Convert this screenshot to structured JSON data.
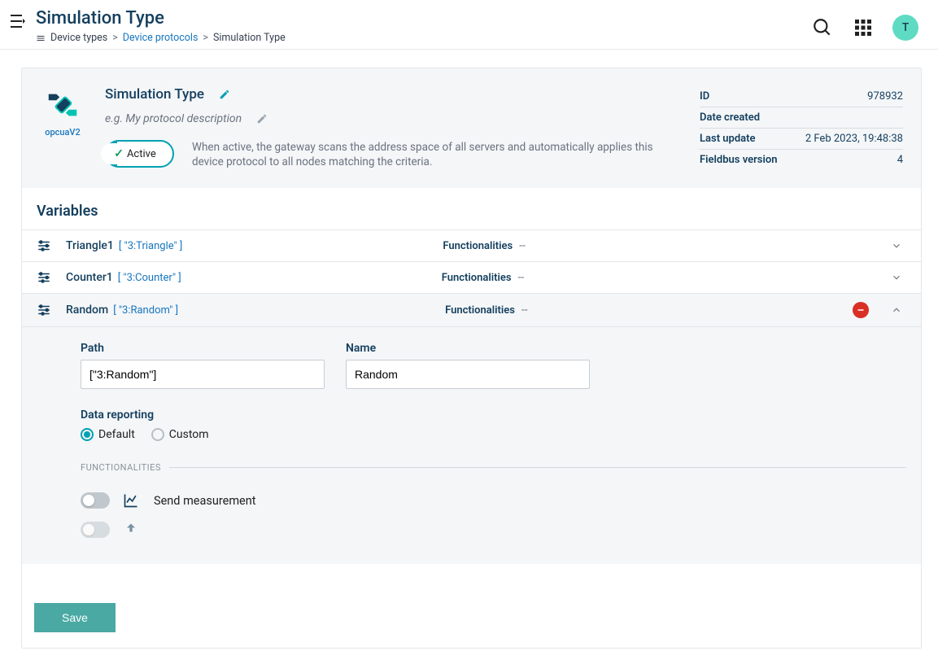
{
  "header": {
    "page_title": "Simulation Type",
    "avatar_letter": "T"
  },
  "breadcrumb": {
    "item0": "Device types",
    "item1": "Device protocols",
    "item2": "Simulation Type"
  },
  "protocol": {
    "icon_label": "opcuaV2",
    "title": "Simulation Type",
    "desc_placeholder": "e.g. My protocol description",
    "active_label": "Active",
    "active_help": "When active, the gateway scans the address space of all servers and automatically applies this device protocol to all nodes matching the criteria."
  },
  "meta": {
    "rows": [
      {
        "key": "ID",
        "val": "978932"
      },
      {
        "key": "Date created",
        "val": ""
      },
      {
        "key": "Last update",
        "val": "2 Feb 2023, 19:48:38"
      },
      {
        "key": "Fieldbus version",
        "val": "4"
      }
    ]
  },
  "variables": {
    "heading": "Variables",
    "func_label": "Functionalities",
    "func_dash": "--",
    "items": [
      {
        "name": "Triangle1",
        "badge": "[ \"3:Triangle\" ]",
        "expanded": false
      },
      {
        "name": "Counter1",
        "badge": "[ \"3:Counter\" ]",
        "expanded": false
      },
      {
        "name": "Random",
        "badge": "[ \"3:Random\" ]",
        "expanded": true
      }
    ]
  },
  "expanded": {
    "path_label": "Path",
    "path_value": "[\"3:Random\"]",
    "name_label": "Name",
    "name_value": "Random",
    "reporting_label": "Data reporting",
    "reporting_opts": {
      "default": "Default",
      "custom": "Custom"
    },
    "func_heading": "FUNCTIONALITIES",
    "send_measurement": "Send measurement"
  },
  "footer": {
    "save": "Save"
  }
}
